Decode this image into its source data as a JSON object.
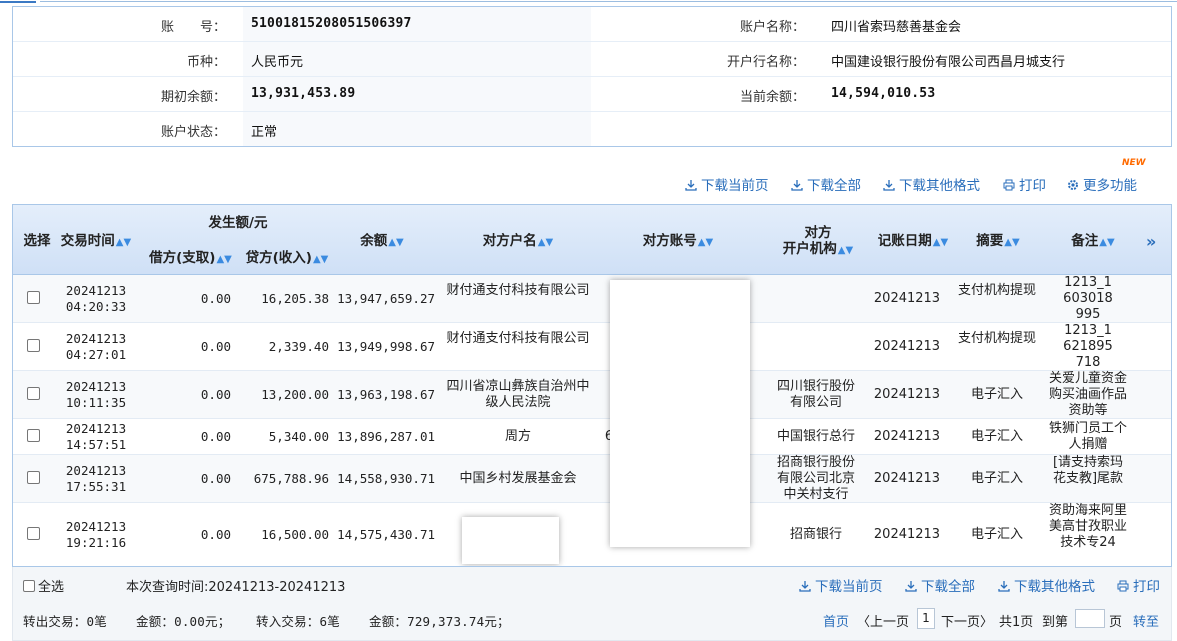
{
  "account": {
    "account_no_label": "账　　号：",
    "account_no": "51001815208051506397",
    "account_name_label": "账户名称：",
    "account_name": "四川省索玛慈善基金会",
    "currency_label": "币种：",
    "currency": "人民币元",
    "bank_label": "开户行名称：",
    "bank": "中国建设银行股份有限公司西昌月城支行",
    "opening_balance_label": "期初余额：",
    "opening_balance": "13,931,453.89",
    "current_balance_label": "当前余额：",
    "current_balance": "14,594,010.53",
    "status_label": "账户状态：",
    "status": "正常"
  },
  "toolbar": {
    "download_page": "下载当前页",
    "download_all": "下载全部",
    "download_other": "下载其他格式",
    "print": "打印",
    "more": "更多功能",
    "new_badge": "NEW"
  },
  "table": {
    "headers": {
      "select": "选择",
      "time": "交易时间",
      "amount_group": "发生额/元",
      "debit": "借方(支取)",
      "credit": "贷方(收入)",
      "balance": "余额",
      "party_name": "对方户名",
      "party_account": "对方账号",
      "party_bank_1": "对方",
      "party_bank_2": "开户机构",
      "post_date": "记账日期",
      "summary": "摘要",
      "remark": "备注",
      "more": "»"
    },
    "rows": [
      {
        "date": "20241213",
        "time": "04:20:33",
        "debit": "0.00",
        "credit": "16,205.38",
        "balance": "13,947,659.27",
        "party_name": "财付通支付科技有限公司",
        "party_account": "",
        "party_bank": "",
        "post_date": "20241213",
        "summary": "支付机构提现",
        "remark": "1213_1603018995"
      },
      {
        "date": "20241213",
        "time": "04:27:01",
        "debit": "0.00",
        "credit": "2,339.40",
        "balance": "13,949,998.67",
        "party_name": "财付通支付科技有限公司",
        "party_account": "",
        "party_bank": "",
        "post_date": "20241213",
        "summary": "支付机构提现",
        "remark": "1213_1621895718"
      },
      {
        "date": "20241213",
        "time": "10:11:35",
        "debit": "0.00",
        "credit": "13,200.00",
        "balance": "13,963,198.67",
        "party_name": "四川省凉山彝族自治州中级人民法院",
        "party_account": "",
        "party_bank": "四川银行股份有限公司",
        "post_date": "20241213",
        "summary": "电子汇入",
        "remark": "关爱儿童资金购买油画作品资助等"
      },
      {
        "date": "20241213",
        "time": "14:57:51",
        "debit": "0.00",
        "credit": "5,340.00",
        "balance": "13,896,287.01",
        "party_name": "周方",
        "party_account": "6",
        "party_bank": "中国银行总行",
        "post_date": "20241213",
        "summary": "电子汇入",
        "remark": "铁狮门员工个人捐赠"
      },
      {
        "date": "20241213",
        "time": "17:55:31",
        "debit": "0.00",
        "credit": "675,788.96",
        "balance": "14,558,930.71",
        "party_name": "中国乡村发展基金会",
        "party_account": "",
        "party_bank": "招商银行股份有限公司北京中关村支行",
        "post_date": "20241213",
        "summary": "电子汇入",
        "remark": "[请支持索玛花支教]尾款"
      },
      {
        "date": "20241213",
        "time": "19:21:16",
        "debit": "0.00",
        "credit": "16,500.00",
        "balance": "14,575,430.71",
        "party_name": "",
        "party_account": "",
        "party_bank": "招商银行",
        "post_date": "20241213",
        "summary": "电子汇入",
        "remark": "资助海来阿里美高甘孜职业技术专24"
      }
    ]
  },
  "footer": {
    "select_all": "全选",
    "query_range": "本次查询时间:20241213-20241213",
    "out_count": "转出交易：0笔",
    "out_amount": "金额：0.00元；",
    "in_count": "转入交易：6笔",
    "in_amount": "金额：729,373.74元；",
    "first": "首页",
    "prev": "〈上一页",
    "page": "1",
    "next": "下一页〉",
    "total": "共1页",
    "goto_prefix": "到第",
    "goto_suffix": "页",
    "go": "转至"
  },
  "colors": {
    "link": "#2a6ebb",
    "header_bg": "#cfe0f6",
    "border": "#a9c7e8"
  }
}
